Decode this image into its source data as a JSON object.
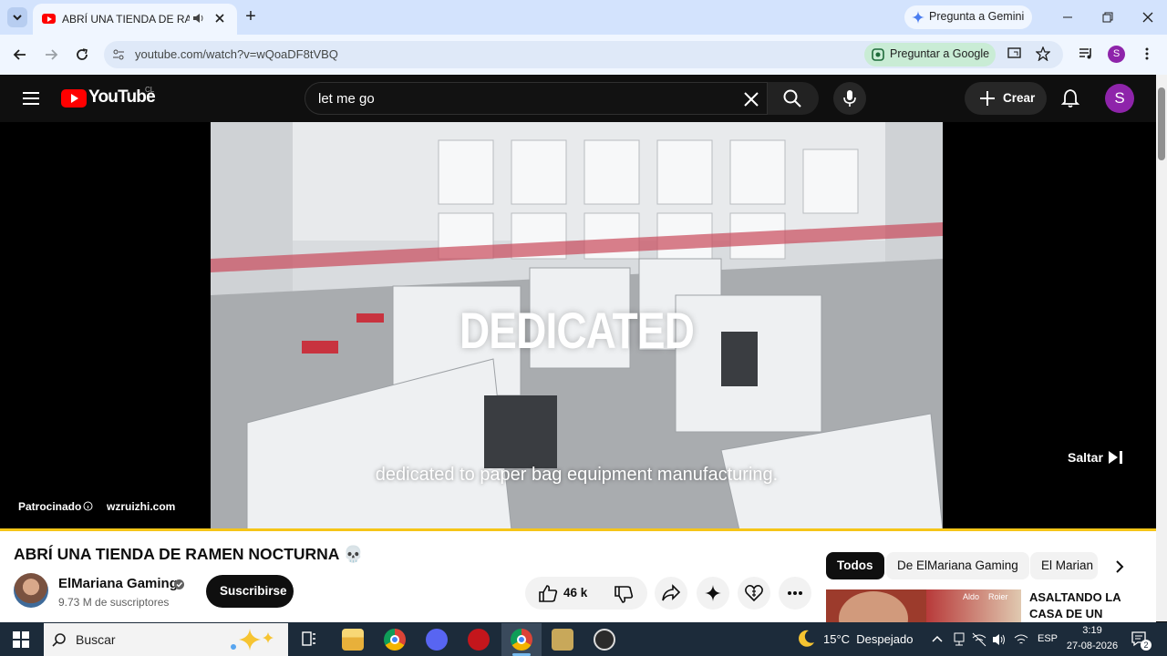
{
  "browser": {
    "tab_title": "ABRÍ UNA TIENDA DE RAMEN",
    "new_tab": "+",
    "gemini_label": "Pregunta a Gemini",
    "url": "youtube.com/watch?v=wQoaDF8tVBQ",
    "ask_google": "Preguntar a Google",
    "profile_initial": "S"
  },
  "youtube": {
    "logo_text": "YouTube",
    "region": "CL",
    "search_value": "let me go",
    "create_label": "Crear",
    "avatar_initial": "S"
  },
  "ad": {
    "headline": "DEDICATED",
    "caption": "dedicated to paper bag equipment manufacturing.",
    "sponsored": "Patrocinado",
    "advertiser": "wzruizhi.com",
    "skip": "Saltar"
  },
  "video": {
    "title": "ABRÍ UNA TIENDA DE RAMEN NOCTURNA 💀",
    "channel": "ElMariana Gaming",
    "subscribers": "9.73 M de suscriptores",
    "subscribe": "Suscribirse",
    "likes": "46 k"
  },
  "recommend": {
    "chips": [
      "Todos",
      "De ElMariana Gaming",
      "El Marian"
    ],
    "next_title": "ASALTANDO LA CASA DE UN",
    "thumb_labels": [
      "Aldo",
      "Roier"
    ]
  },
  "taskbar": {
    "search": "Buscar",
    "weather": "15°C  Despejado",
    "lang": "ESP",
    "time": "3:19",
    "date": "27-08-2026",
    "notif": "2"
  },
  "colors": {
    "accent_red": "#ff0000",
    "progress": "#f5c518"
  }
}
